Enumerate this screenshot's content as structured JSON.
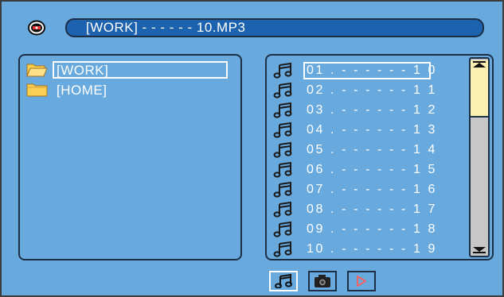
{
  "title_bar": {
    "path": "[WORK] - - - - - - 10.MP3"
  },
  "folders": [
    {
      "label": "[WORK]",
      "selected": true
    },
    {
      "label": "[HOME]",
      "selected": false
    }
  ],
  "tracks": [
    {
      "label": "01 . - - - - - - 1 0",
      "selected": true
    },
    {
      "label": "02 . - - - - - - 1 1"
    },
    {
      "label": "03 . - - - - - - 1 2"
    },
    {
      "label": "04 . - - - - - - 1 3"
    },
    {
      "label": "05 . - - - - - - 1 4"
    },
    {
      "label": "06 . - - - - - - 1 5"
    },
    {
      "label": "07 . - - - - - - 1 6"
    },
    {
      "label": "08 . - - - - - - 1 7"
    },
    {
      "label": "09 . - - - - - - 1 8"
    },
    {
      "label": "10 . - - - - - - 1 9"
    }
  ],
  "bottom_buttons": [
    {
      "icon": "music-note-icon",
      "selected": true
    },
    {
      "icon": "camera-icon",
      "selected": false
    },
    {
      "icon": "play-icon",
      "selected": false
    }
  ],
  "colors": {
    "background": "#68a9de",
    "title_bar": "#1d62ae",
    "scroll_thumb": "#fbf0b0",
    "folder": "#fbcf52",
    "play_arrow": "#f16464"
  }
}
